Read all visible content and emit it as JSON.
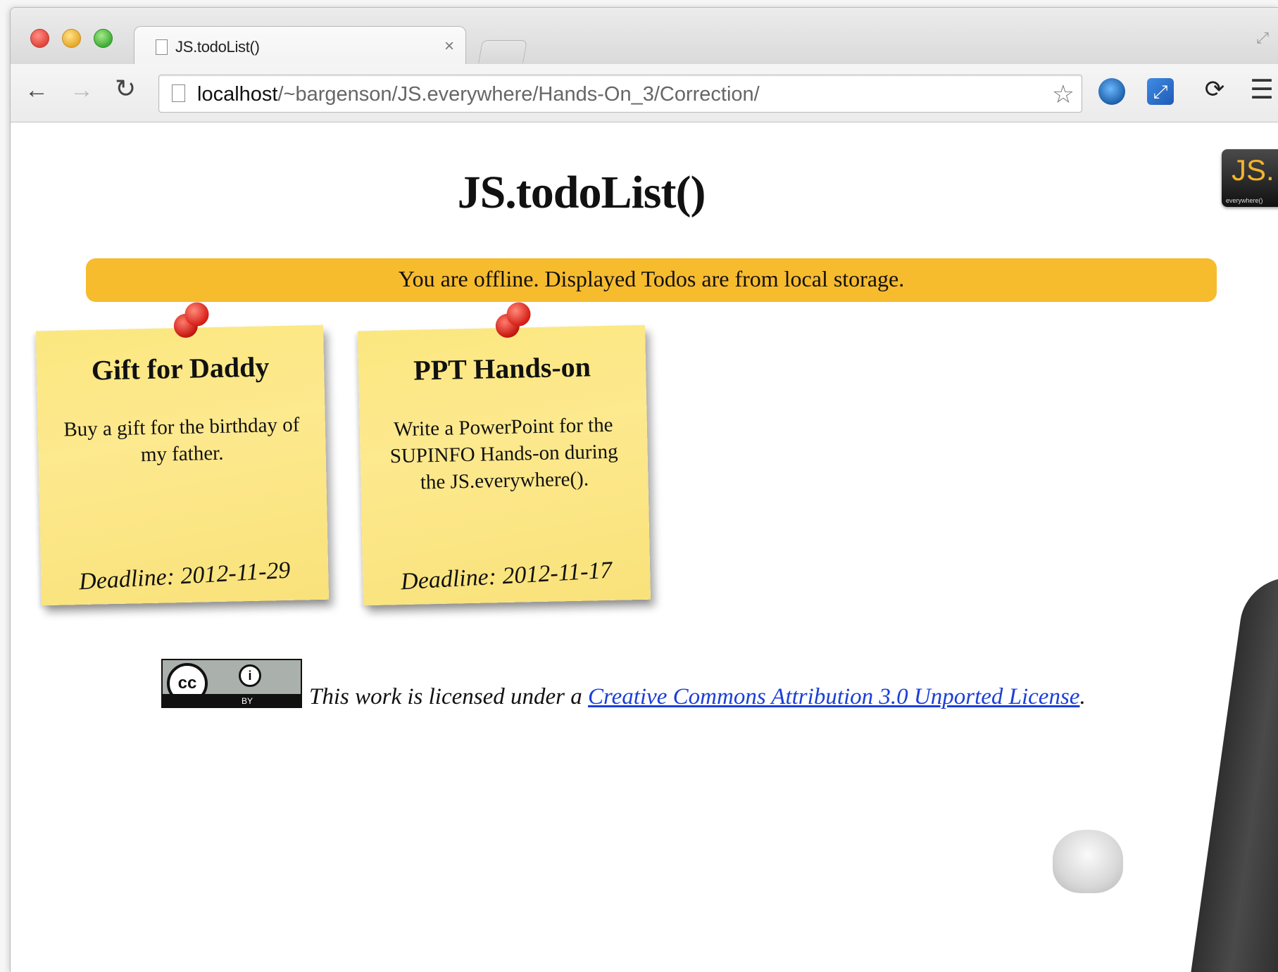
{
  "browser": {
    "tab_title": "JS.todoList()",
    "tab_close": "×",
    "url_host": "localhost",
    "url_path": "/~bargenson/JS.everywhere/Hands-On_3/Correction/",
    "icons": [
      "back-arrow-icon",
      "forward-arrow-icon",
      "reload-icon",
      "page-icon",
      "star-icon",
      "globe-extension-icon",
      "resize-extension-icon",
      "sync-extension-icon",
      "menu-icon"
    ]
  },
  "page": {
    "title": "JS.todoList()",
    "logo": {
      "text": "JS.",
      "subtext": "everywhere()"
    },
    "offline_message": "You are offline. Displayed Todos are from local storage.",
    "banner_color": "#f7bb2e"
  },
  "todos": [
    {
      "title": "Gift for Daddy",
      "description": "Buy a gift for the birthday of my father.",
      "deadline": "Deadline: 2012-11-29"
    },
    {
      "title": "PPT Hands-on",
      "description": "Write a PowerPoint for the SUPINFO Hands-on during the JS.everywhere().",
      "deadline": "Deadline: 2012-11-17"
    }
  ],
  "license": {
    "badge_cc": "cc",
    "badge_by": "BY",
    "prefix": "This work is licensed under a ",
    "link_text": "Creative Commons Attribution 3.0 Unported License",
    "suffix": "."
  }
}
